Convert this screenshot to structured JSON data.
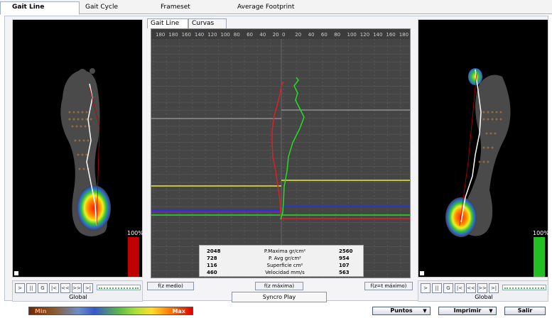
{
  "top_tabs": [
    {
      "label": "Gait Line"
    },
    {
      "label": "Gait Cycle"
    },
    {
      "label": "Frameset"
    },
    {
      "label": "Average Footprint"
    }
  ],
  "center_tabs": [
    {
      "label": "Gait Line"
    },
    {
      "label": "Curvas"
    }
  ],
  "ruler_ticks_left": [
    "180",
    "180",
    "160",
    "140",
    "120",
    "100",
    "80",
    "60",
    "40",
    "20"
  ],
  "ruler_ticks_right": [
    "0",
    "20",
    "40",
    "60",
    "80",
    "100",
    "120",
    "140",
    "160",
    "180"
  ],
  "left_panel": {
    "percent": "100%",
    "bar_color": "#c00000",
    "label": "Global"
  },
  "right_panel": {
    "percent": "100%",
    "bar_color": "#22c022",
    "label": "Global"
  },
  "controls": [
    ">",
    "||",
    "G",
    "|<",
    "<<",
    ">>",
    ">|"
  ],
  "stats": [
    {
      "left": "2048",
      "label": "P.Maxima gr/cm²",
      "right": "2560"
    },
    {
      "left": "728",
      "label": "P. Avg gr/cm²",
      "right": "954"
    },
    {
      "left": "116",
      "label": "Superficie cm²",
      "right": "107"
    },
    {
      "left": "460",
      "label": "Velocidad mm/s",
      "right": "563"
    }
  ],
  "buttons": {
    "f_medio": "f(z medio)",
    "f_maxima": "f(z máxima)",
    "f_t_maximo": "f(z=t máximo)",
    "syncro_play": "Syncro Play",
    "puntos": "Puntos",
    "imprimir": "Imprimir",
    "salir": "Salir"
  },
  "legend": {
    "min": "Min",
    "max": "Max"
  },
  "colors": {
    "left_curve": "#e02020",
    "right_curve": "#20e020",
    "yellow_line": "#f0f020",
    "blue_line": "#2030ff",
    "gray_line": "#b0b0b0"
  }
}
